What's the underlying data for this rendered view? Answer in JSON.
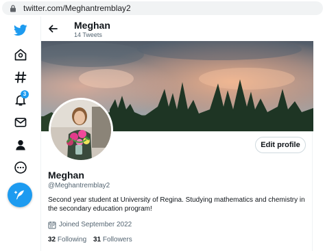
{
  "browser": {
    "url": "twitter.com/Meghantremblay2"
  },
  "nav": {
    "items": [
      "twitter-logo",
      "home-icon",
      "explore-icon",
      "notifications-icon",
      "messages-icon",
      "profile-icon",
      "more-icon"
    ],
    "notification_count": "3",
    "accent_color": "#1d9bf0"
  },
  "header": {
    "name": "Meghan",
    "tweet_count": "14 Tweets"
  },
  "profile": {
    "name": "Meghan",
    "handle": "@Meghantremblay2",
    "bio": "Second year student at University of Regina. Studying mathematics and chemistry in the secondary education program!",
    "joined": "Joined September 2022",
    "following_count": "32",
    "following_label": "Following",
    "followers_count": "31",
    "followers_label": "Followers",
    "edit_button": "Edit profile"
  }
}
